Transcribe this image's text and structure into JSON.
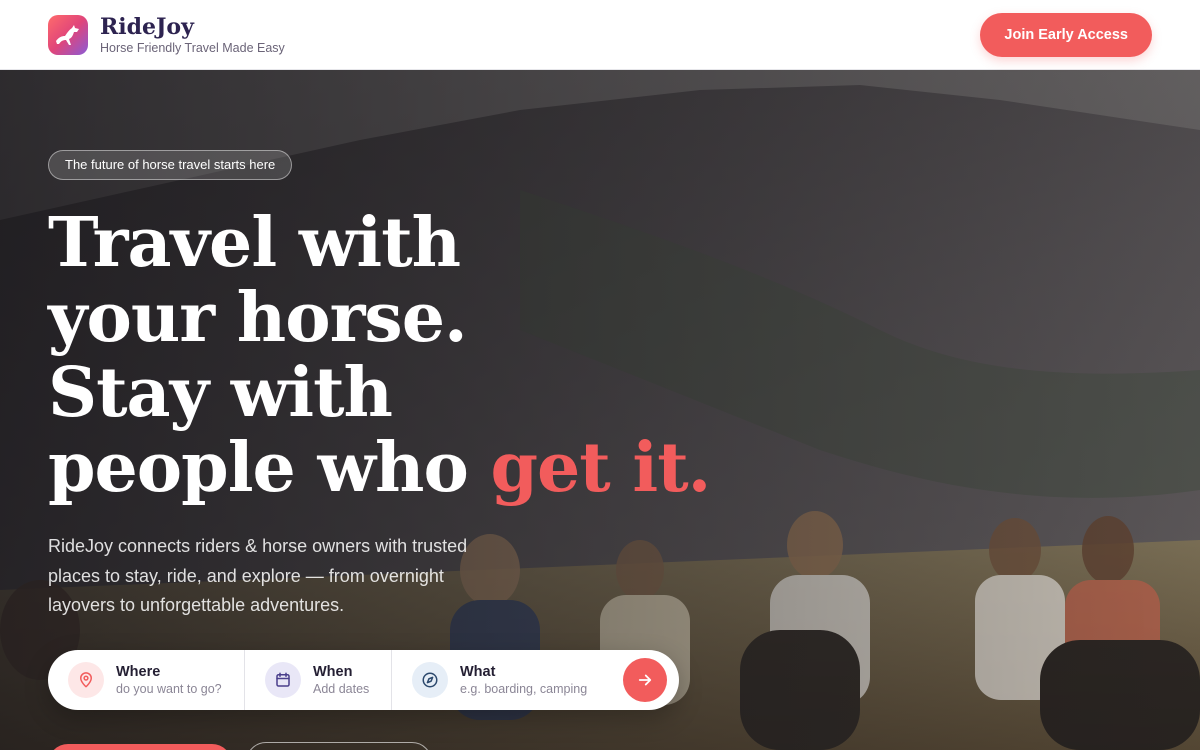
{
  "header": {
    "brand_name": "RideJoy",
    "brand_tagline": "Horse Friendly Travel Made Easy",
    "cta_label": "Join Early Access"
  },
  "hero": {
    "pill_text": "The future of horse travel starts here",
    "headline": {
      "line1": "Travel with",
      "line2": "your horse.",
      "line3": "Stay with",
      "line4_prefix": "people who ",
      "line4_accent": "get it."
    },
    "subcopy": "RideJoy connects riders & horse owners with trusted places to stay, ride, and explore — from overnight layovers to unforgettable adventures."
  },
  "search": {
    "where": {
      "label": "Where",
      "hint": "do you want to go?",
      "icon": "map-pin-icon"
    },
    "when": {
      "label": "When",
      "hint": "Add dates",
      "icon": "calendar-icon"
    },
    "what": {
      "label": "What",
      "hint": "e.g. boarding, camping",
      "icon": "navigation-icon"
    },
    "submit_icon": "arrow-right-icon"
  },
  "colors": {
    "accent": "#f25c5c",
    "brand_text": "#2d2350",
    "where_icon_bg": "#fde7e7",
    "when_icon_bg": "#e9e7f7",
    "what_icon_bg": "#e6eef7"
  }
}
